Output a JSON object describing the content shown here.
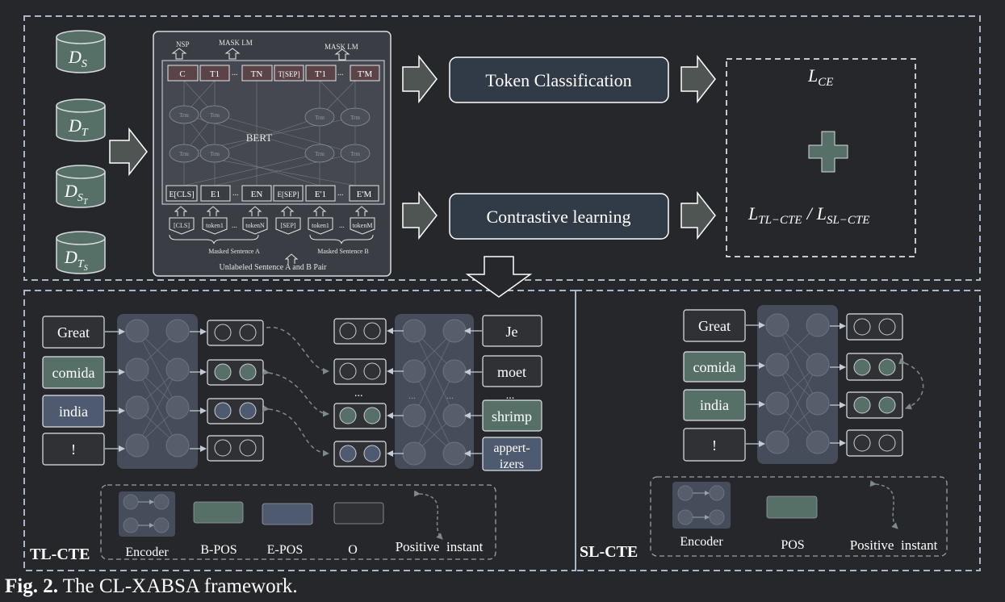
{
  "top": {
    "datasets": [
      {
        "main": "D",
        "sub": "S",
        "subsub": ""
      },
      {
        "main": "D",
        "sub": "T",
        "subsub": ""
      },
      {
        "main": "D",
        "sub": "S",
        "subsub": "T"
      },
      {
        "main": "D",
        "sub": "T",
        "subsub": "S"
      }
    ],
    "bert": {
      "nsp": "NSP",
      "mask_lm_1": "MASK LM",
      "mask_lm_2": "MASK LM",
      "model_label": "BERT",
      "trm": "Trm",
      "out_tokens": [
        "C",
        "T1",
        "TN",
        "T[SEP]",
        "T'1",
        "T'M"
      ],
      "emb_tokens": [
        "E[CLS]",
        "E1",
        "EN",
        "E[SEP]",
        "E'1",
        "E'M"
      ],
      "inputs": [
        "[CLS]",
        "token1",
        "tokenN",
        "[SEP]",
        "token1",
        "tokenM"
      ],
      "dots": "...",
      "masked_a": "Masked Sentence A",
      "masked_b": "Masked Sentence B",
      "pair": "Unlabeled Sentence A and B Pair"
    },
    "token_classification": "Token Classification",
    "contrastive_learning": "Contrastive learning",
    "loss_ce": "L",
    "loss_ce_sub": "CE",
    "loss_tl": "L",
    "loss_tl_sub": "TL−CTE",
    "loss_sep": "/",
    "loss_sl": "L",
    "loss_sl_sub": "SL−CTE"
  },
  "tl": {
    "title": "TL-CTE",
    "left_words": [
      "Great",
      "comida",
      "india",
      "!"
    ],
    "right_words": [
      "Je",
      "moet",
      "...",
      "shrimp",
      "appert-",
      "izers"
    ],
    "dots": "...",
    "legend": {
      "encoder": "Encoder",
      "bpos": "B-POS",
      "epos": "E-POS",
      "o": "O",
      "positive": "Positive  instant"
    }
  },
  "sl": {
    "title": "SL-CTE",
    "words": [
      "Great",
      "comida",
      "india",
      "!"
    ],
    "legend": {
      "encoder": "Encoder",
      "pos": "POS",
      "positive": "Positive  instant"
    }
  },
  "caption": {
    "bold": "Fig. 2.",
    "text": " The CL-XABSA framework."
  },
  "colors": {
    "background": "#26272b",
    "dashed_border": "#a9b6c9",
    "b_pos": "#566f67",
    "e_pos": "#4e5a70",
    "o": "#2f3134",
    "encoder": "#454c5a"
  }
}
